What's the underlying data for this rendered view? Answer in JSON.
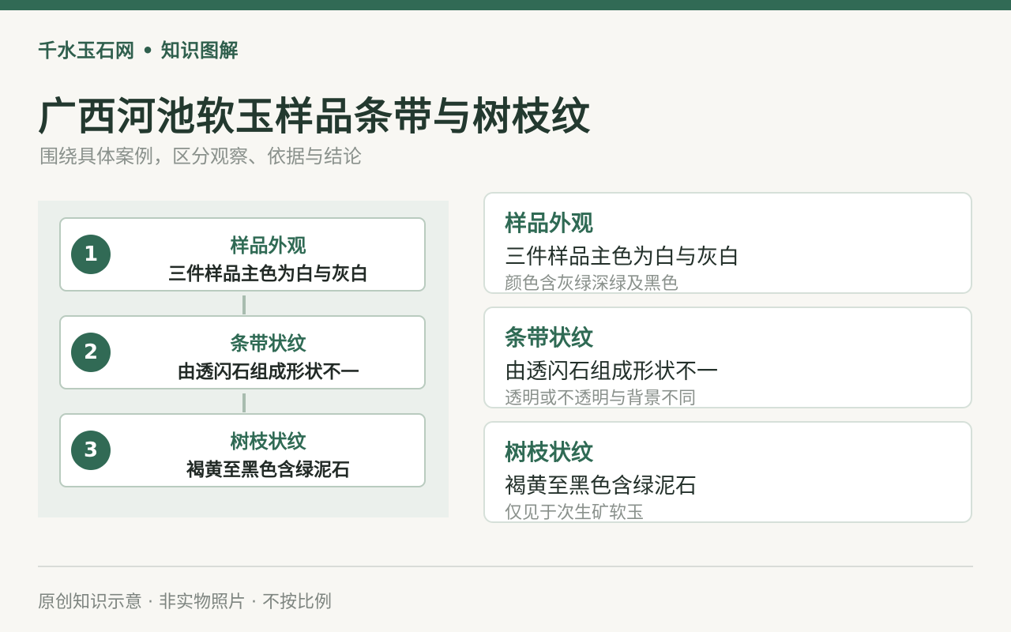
{
  "brand": "千水玉石网 • 知识图解",
  "title": "广西河池软玉样品条带与树枝纹",
  "subtitle": "围绕具体案例，区分观察、依据与结论",
  "steps": [
    {
      "num": "1",
      "title": "样品外观",
      "desc": "三件样品主色为白与灰白"
    },
    {
      "num": "2",
      "title": "条带状纹",
      "desc": "由透闪石组成形状不一"
    },
    {
      "num": "3",
      "title": "树枝状纹",
      "desc": "褐黄至黑色含绿泥石"
    }
  ],
  "cards": [
    {
      "title": "样品外观",
      "main": "三件样品主色为白与灰白",
      "note": "颜色含灰绿深绿及黑色"
    },
    {
      "title": "条带状纹",
      "main": "由透闪石组成形状不一",
      "note": "透明或不透明与背景不同"
    },
    {
      "title": "树枝状纹",
      "main": "褐黄至黑色含绿泥石",
      "note": "仅见于次生矿软玉"
    }
  ],
  "footer": "原创知识示意 · 非实物照片 · 不按比例",
  "colors": {
    "accent": "#316a55",
    "panel": "#ebf0ec",
    "background": "#f8f7f3"
  }
}
